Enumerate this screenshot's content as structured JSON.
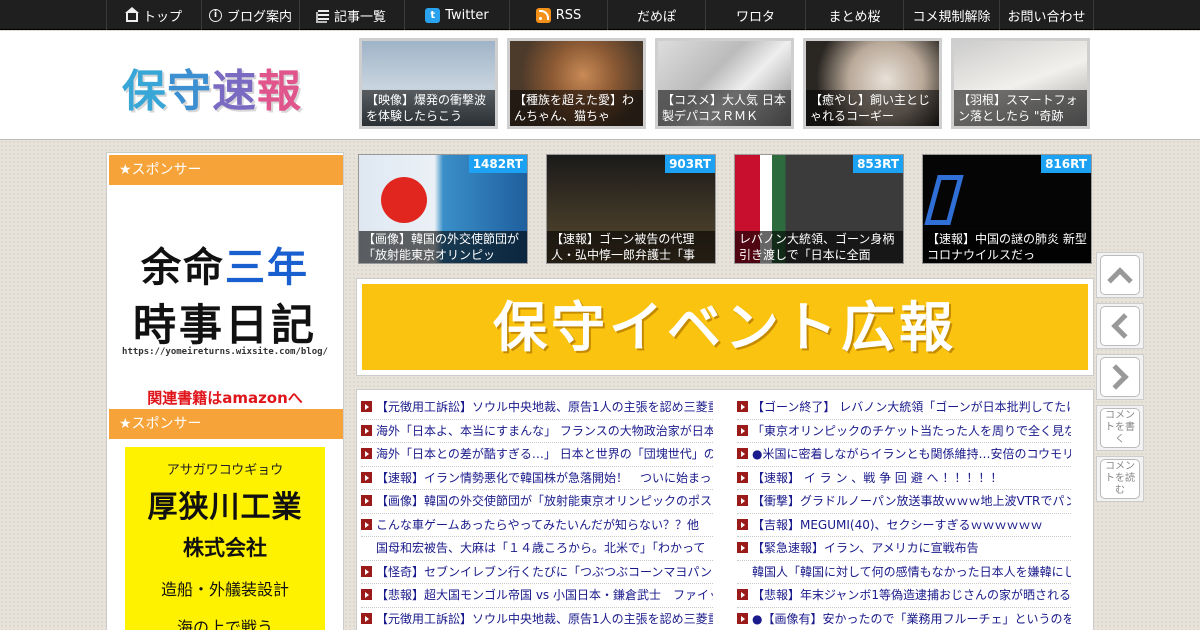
{
  "nav": [
    {
      "label": "トップ",
      "icon": "home-icon"
    },
    {
      "label": "ブログ案内",
      "icon": "info-icon"
    },
    {
      "label": "記事一覧",
      "icon": "list-icon"
    },
    {
      "label": "Twitter",
      "icon": "twitter-icon"
    },
    {
      "label": "RSS",
      "icon": "rss-icon"
    },
    {
      "label": "だめぽ"
    },
    {
      "label": "ワロタ"
    },
    {
      "label": "まとめ桜"
    },
    {
      "label": "コメ規制解除"
    },
    {
      "label": "お問い合わせ"
    }
  ],
  "header": {
    "logo": [
      "保",
      "守",
      "速",
      "報"
    ],
    "thumbs": [
      {
        "caption": "【映像】爆発の衝撃波を体験したらこう"
      },
      {
        "caption": "【種族を超えた愛】わんちゃん、猫ちゃ"
      },
      {
        "caption": "【コスメ】大人気 日本製デパコスＲＭＫ"
      },
      {
        "caption": "【癒やし】飼い主とじゃれるコーギー"
      },
      {
        "caption": "【羽根】スマートフォン落としたら \"奇跡"
      }
    ]
  },
  "sidebar": {
    "sponsor_label": "★スポンサー",
    "ad1": {
      "line1a": "余命",
      "line1b": "三年",
      "line2": "時事日記",
      "url": "https://yomeireturns.wixsite.com/blog/",
      "book": "関連書籍はamazonへ"
    },
    "ad2": {
      "kana": "アサガワコウギョウ",
      "name": "厚狭川工業",
      "suffix": "株式会社",
      "desc": "造船・外艤装設計",
      "extra": "海の上で戦う"
    }
  },
  "rt_cards": [
    {
      "rt": "1482RT",
      "caption": "【画像】韓国の外交使節団が「放射能東京オリンピッ"
    },
    {
      "rt": "903RT",
      "caption": "【速報】ゴーン被告の代理人・弘中惇一郎弁護士「事"
    },
    {
      "rt": "853RT",
      "caption": "レバノン大統領、ゴーン身柄引き渡しで「日本に全面"
    },
    {
      "rt": "816RT",
      "caption": "【速報】中国の謎の肺炎 新型コロナウイルスだっ"
    }
  ],
  "banner": {
    "text": "保守イベント広報"
  },
  "float_buttons": {
    "comment_write": "コメントを書く",
    "comment_read": "コメントを読む"
  },
  "headlines_left": [
    {
      "text": "【元徴用工訴訟】ソウル中央地裁、原告1人の主張を認め三菱重"
    },
    {
      "text": "海外「日本よ、本当にすまんな」 フランスの大物政治家が日本"
    },
    {
      "text": "海外「日本との差が酷すぎる…」 日本と世界の「団塊世代」の"
    },
    {
      "text": "【速報】イラン情勢悪化で韓国株が急落開始！　ついに始まっ"
    },
    {
      "text": "【画像】韓国の外交使節団が「放射能東京オリンピックのポス"
    },
    {
      "text": "こんな車ゲームあったらやってみたいんだが知らない？？他"
    },
    {
      "text": "国母和宏被告、大麻は「１４歳ころから。北米で」「わかって",
      "noarrow": true
    },
    {
      "text": "【怪奇】セブンイレブン行くたびに「つぶつぶコーンマヨパン"
    },
    {
      "text": "【悲報】超大国モンゴル帝国 vs 小国日本・鎌倉武士　ファイッ！"
    },
    {
      "text": "【元徴用工訴訟】ソウル中央地裁、原告1人の主張を認め三菱重"
    }
  ],
  "headlines_right": [
    {
      "text": "【ゴーン終了】 レバノン大統領「ゴーンが日本批判してたけど"
    },
    {
      "text": "「東京オリンピックのチケット当たった人を周りで全く見ない"
    },
    {
      "text": "●米国に密着しながらイランとも関係維持…安倍のコウモリ外"
    },
    {
      "text": "【速報】 イ ラ ン 、戦 争 回 避 へ ！！！！！"
    },
    {
      "text": "【衝撃】グラドルノーパン放送事故ｗｗｗ地上波VTRでパンツ"
    },
    {
      "text": "【吉報】MEGUMI(40)、セクシーすぎるｗｗｗｗｗｗ"
    },
    {
      "text": "【緊急速報】イラン、アメリカに宣戦布告"
    },
    {
      "text": "韓国人「韓国に対して何の感情もなかった日本人を嫌韓にした",
      "noarrow": true
    },
    {
      "text": "【悲報】年末ジャンボ1等偽造逮捕おじさんの家が晒されるｗｗ"
    },
    {
      "text": "●【画像有】安かったので「業務用フルーチェ」というのを買"
    }
  ]
}
